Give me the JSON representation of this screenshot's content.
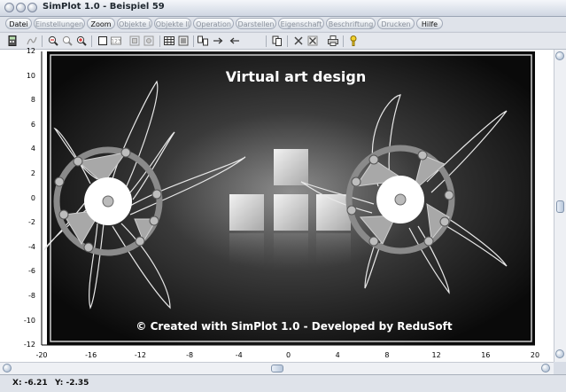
{
  "window": {
    "title": "SimPlot 1.0 - Beispiel 59"
  },
  "menu": [
    {
      "label": "Datei",
      "enabled": true
    },
    {
      "label": "Einstellungen",
      "enabled": false
    },
    {
      "label": "Zoom",
      "enabled": true
    },
    {
      "label": "Objekte I",
      "enabled": false
    },
    {
      "label": "Objekte II",
      "enabled": false
    },
    {
      "label": "Operation",
      "enabled": false
    },
    {
      "label": "Darstellen",
      "enabled": false
    },
    {
      "label": "Eigenschaft",
      "enabled": false
    },
    {
      "label": "Beschriftung",
      "enabled": false
    },
    {
      "label": "Drucken",
      "enabled": false
    },
    {
      "label": "Hilfe",
      "enabled": true
    }
  ],
  "toolbar": {
    "icons": [
      "calculator-icon",
      "function-icon",
      "zoom-in-icon",
      "zoom-out-icon",
      "zoom-fit-icon",
      "select-rect-icon",
      "select-value-icon",
      "object-icon",
      "object-copy-icon",
      "grid-icon",
      "capture-icon",
      "mirror-icon",
      "move-right-icon",
      "move-left-icon",
      "copy-icon",
      "delete-icon",
      "delete-all-icon",
      "print-icon",
      "help-icon"
    ]
  },
  "plot": {
    "y_ticks": [
      "12",
      "10",
      "8",
      "6",
      "4",
      "2",
      "0",
      "-2",
      "-4",
      "-6",
      "-8",
      "-10",
      "-12"
    ],
    "x_ticks": [
      "-20",
      "-16",
      "-12",
      "-8",
      "-4",
      "0",
      "4",
      "8",
      "12",
      "16",
      "20"
    ],
    "title": "Virtual art design",
    "footer": "© Created with SimPlot 1.0 - Developed by ReduSoft",
    "colors": {
      "background": "#0a0a0a",
      "frame": "#cfcfcf",
      "accent": "#9a9a9a"
    }
  },
  "status": {
    "x": "X: -6.21",
    "y": "Y: -2.35"
  }
}
